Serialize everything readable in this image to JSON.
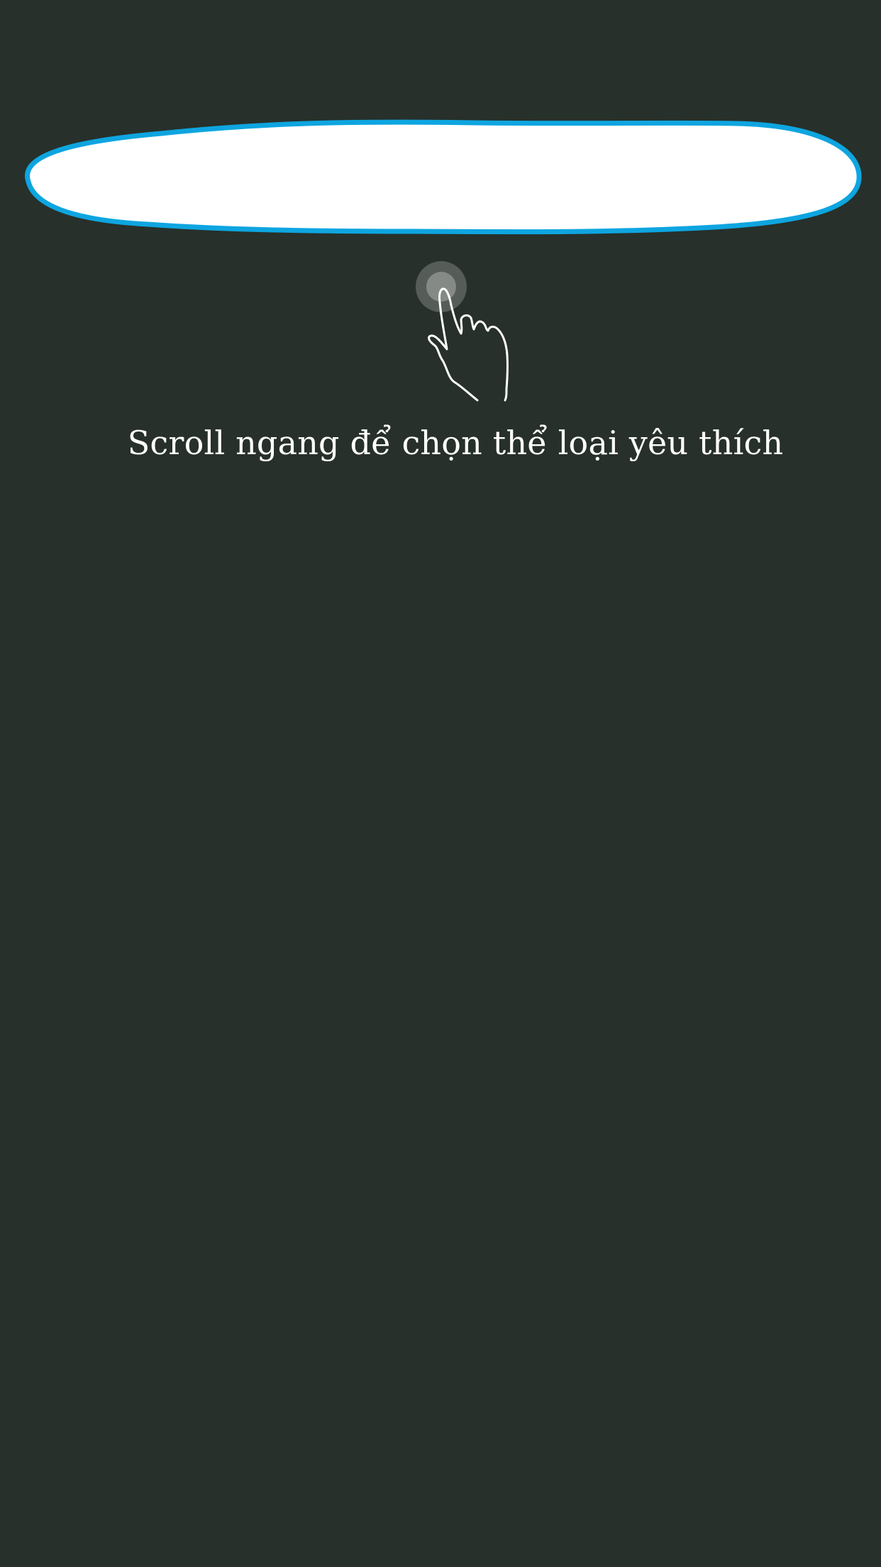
{
  "overlay": {
    "background_color": "#27302a",
    "highlight_fill": "#ffffff",
    "highlight_border_color": "#0ea5e0",
    "gesture_icon": "tap-hand-icon",
    "hint_text": "Scroll ngang để chọn thể loại yêu thích"
  }
}
